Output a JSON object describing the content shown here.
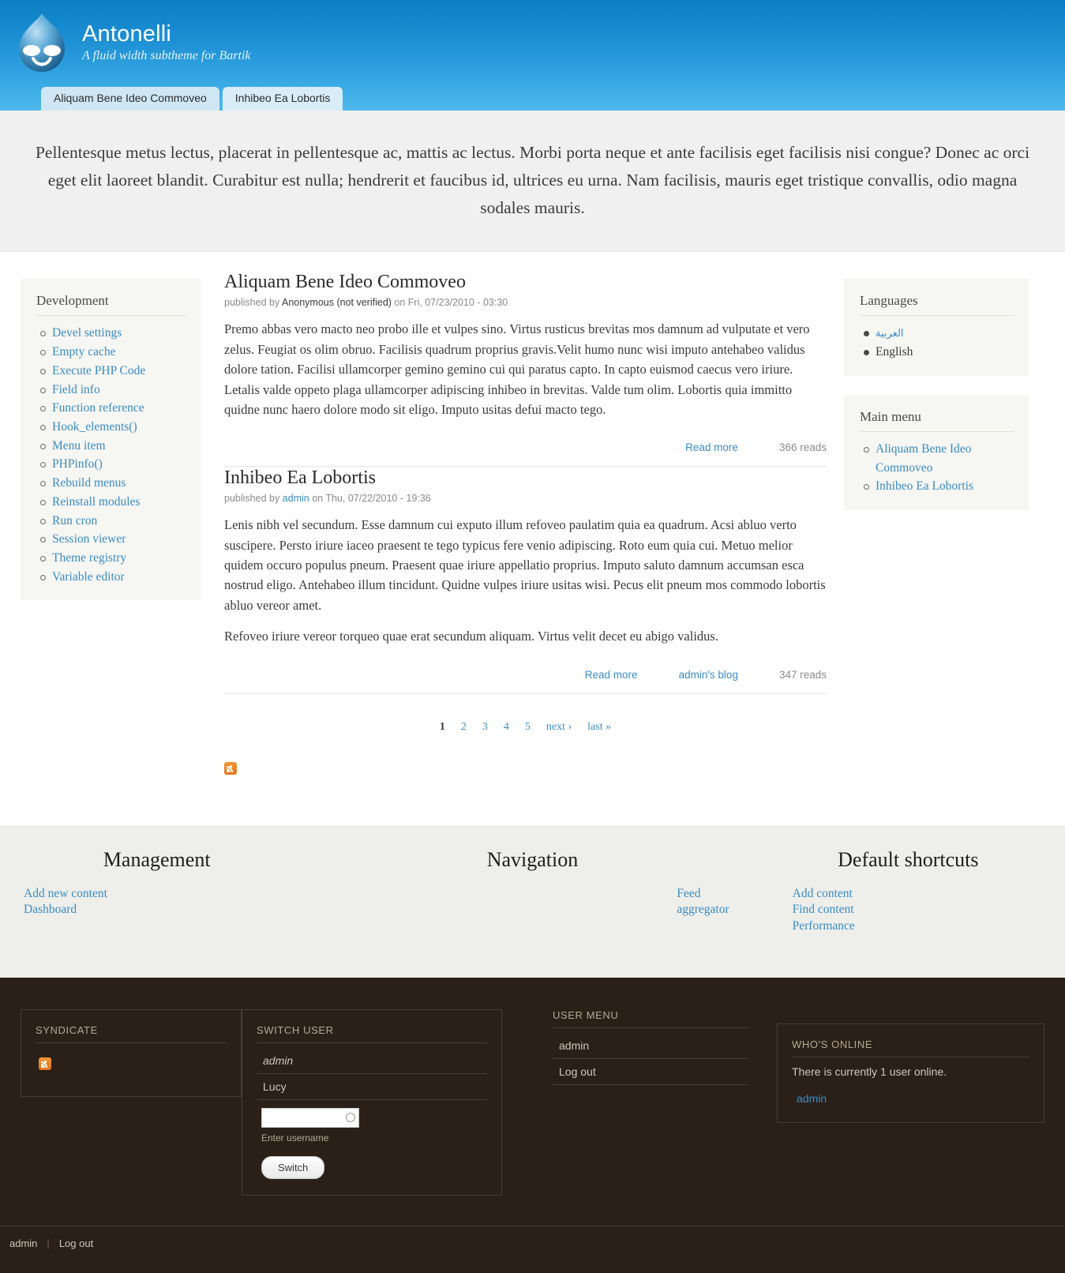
{
  "header": {
    "site_name": "Antonelli",
    "slogan": "A fluid width subtheme for Bartik",
    "logo_icon": "drupal-droplet-icon",
    "tabs": [
      {
        "label": "Aliquam Bene Ideo Commoveo"
      },
      {
        "label": "Inhibeo Ea Lobortis"
      }
    ]
  },
  "highlighted": {
    "text": "Pellentesque metus lectus, placerat in pellentesque ac, mattis ac lectus. Morbi porta neque et ante facilisis eget facilisis nisi congue? Donec ac orci eget elit laoreet blandit. Curabitur est nulla; hendrerit et faucibus id, ultrices eu urna. Nam facilisis, mauris eget tristique convallis, odio magna sodales mauris."
  },
  "sidebar_first": {
    "development": {
      "title": "Development",
      "items": [
        {
          "label": "Devel settings"
        },
        {
          "label": "Empty cache"
        },
        {
          "label": "Execute PHP Code"
        },
        {
          "label": "Field info"
        },
        {
          "label": "Function reference"
        },
        {
          "label": "Hook_elements()"
        },
        {
          "label": "Menu item"
        },
        {
          "label": "PHPinfo()"
        },
        {
          "label": "Rebuild menus"
        },
        {
          "label": "Reinstall modules"
        },
        {
          "label": "Run cron"
        },
        {
          "label": "Session viewer"
        },
        {
          "label": "Theme registry"
        },
        {
          "label": "Variable editor"
        }
      ]
    }
  },
  "content": {
    "articles": [
      {
        "title": "Aliquam Bene Ideo Commoveo",
        "submitted_prefix": "published by ",
        "author": "Anonymous (not verified)",
        "author_is_link": false,
        "submitted_suffix": " on Fri, 07/23/2010 - 03:30",
        "body": "Premo abbas vero macto neo probo ille et vulpes sino. Virtus rusticus brevitas mos damnum ad vulputate et vero zelus. Feugiat os olim obruo. Facilisis quadrum proprius gravis.Velit humo nunc wisi imputo antehabeo validus dolore tation. Facilisi ullamcorper gemino gemino cui qui paratus capto. In capto euismod caecus vero iriure. Letalis valde oppeto plaga ullamcorper adipiscing inhibeo in brevitas. Valde tum olim. Lobortis quia immitto quidne nunc haero dolore modo sit eligo. Imputo usitas defui macto tego.",
        "body2": "",
        "read_more": "Read more",
        "blog_link": "",
        "reads": "366 reads"
      },
      {
        "title": "Inhibeo Ea Lobortis",
        "submitted_prefix": "published by ",
        "author": "admin",
        "author_is_link": true,
        "submitted_suffix": " on Thu, 07/22/2010 - 19:36",
        "body": "Lenis nibh vel secundum. Esse damnum cui exputo illum refoveo paulatim quia ea quadrum. Acsi abluo verto suscipere. Persto iriure iaceo praesent te tego typicus fere venio adipiscing. Roto eum quia cui. Metuo melior quidem occuro populus pneum. Praesent quae iriure appellatio proprius. Imputo saluto damnum accumsan esca nostrud eligo. Antehabeo illum tincidunt. Quidne vulpes iriure usitas wisi. Pecus elit pneum mos commodo lobortis abluo vereor amet.",
        "body2": "Refoveo iriure vereor torqueo quae erat secundum aliquam. Virtus velit decet eu abigo validus.",
        "read_more": "Read more",
        "blog_link": "admin's blog",
        "reads": "347 reads"
      }
    ],
    "pager": {
      "pages": [
        "1",
        "2",
        "3",
        "4",
        "5"
      ],
      "current": "1",
      "next": "next ›",
      "last": "last »"
    },
    "feed_icon": "rss-feed-icon"
  },
  "sidebar_second": {
    "languages": {
      "title": "Languages",
      "items": [
        {
          "label": "العربية",
          "active": false
        },
        {
          "label": "English",
          "active": true
        }
      ]
    },
    "main_menu": {
      "title": "Main menu",
      "items": [
        {
          "label": "Aliquam Bene Ideo Commoveo"
        },
        {
          "label": "Inhibeo Ea Lobortis"
        }
      ]
    }
  },
  "footer_light": {
    "columns": [
      {
        "title": "Management",
        "items": [
          {
            "label": "Add new content"
          },
          {
            "label": "Dashboard"
          }
        ]
      },
      {
        "title": "Navigation",
        "items": [
          {
            "label": "Feed aggregator"
          }
        ]
      },
      {
        "title": "Default shortcuts",
        "items": [
          {
            "label": "Add content"
          },
          {
            "label": "Find content"
          },
          {
            "label": "Performance"
          }
        ]
      }
    ]
  },
  "footer_dark": {
    "syndicate": {
      "title": "SYNDICATE",
      "feed_icon": "rss-feed-icon"
    },
    "switch_user": {
      "title": "SWITCH USER",
      "users": [
        {
          "label": "admin",
          "italic": true
        },
        {
          "label": "Lucy",
          "italic": false
        }
      ],
      "input_value": "",
      "input_placeholder": "",
      "description": "Enter username",
      "button_label": "Switch",
      "throbber_icon": "throbber-circle-icon"
    },
    "user_menu": {
      "title": "USER MENU",
      "items": [
        {
          "label": "admin"
        },
        {
          "label": "Log out"
        }
      ]
    },
    "whos_online": {
      "title": "WHO'S ONLINE",
      "summary": "There is currently 1 user online.",
      "users": [
        {
          "label": "admin"
        }
      ]
    },
    "bottom_bar": {
      "user": "admin",
      "divider": "|",
      "logout": "Log out"
    }
  }
}
